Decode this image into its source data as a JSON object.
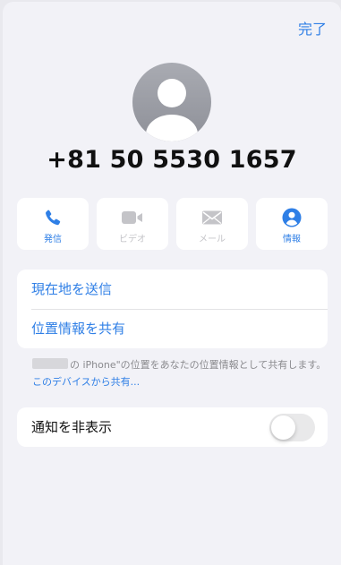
{
  "header": {
    "done_label": "完了"
  },
  "contact": {
    "phone_number": "+81 50 5530 1657"
  },
  "actions": [
    {
      "label": "発信",
      "icon": "phone-icon",
      "enabled": true
    },
    {
      "label": "ビデオ",
      "icon": "video-icon",
      "enabled": false
    },
    {
      "label": "メール",
      "icon": "mail-icon",
      "enabled": false
    },
    {
      "label": "情報",
      "icon": "person-info-icon",
      "enabled": true
    }
  ],
  "location_card": {
    "send_location": "現在地を送信",
    "share_location": "位置情報を共有"
  },
  "footnote": {
    "text": "の iPhone\"の位置をあなたの位置情報として共有します。",
    "link": "このデバイスから共有..."
  },
  "hide_alerts": {
    "label": "通知を非表示",
    "enabled": false
  },
  "colors": {
    "accent": "#2f7fe6",
    "disabled": "#c4c4c8",
    "background": "#f2f2f7"
  }
}
